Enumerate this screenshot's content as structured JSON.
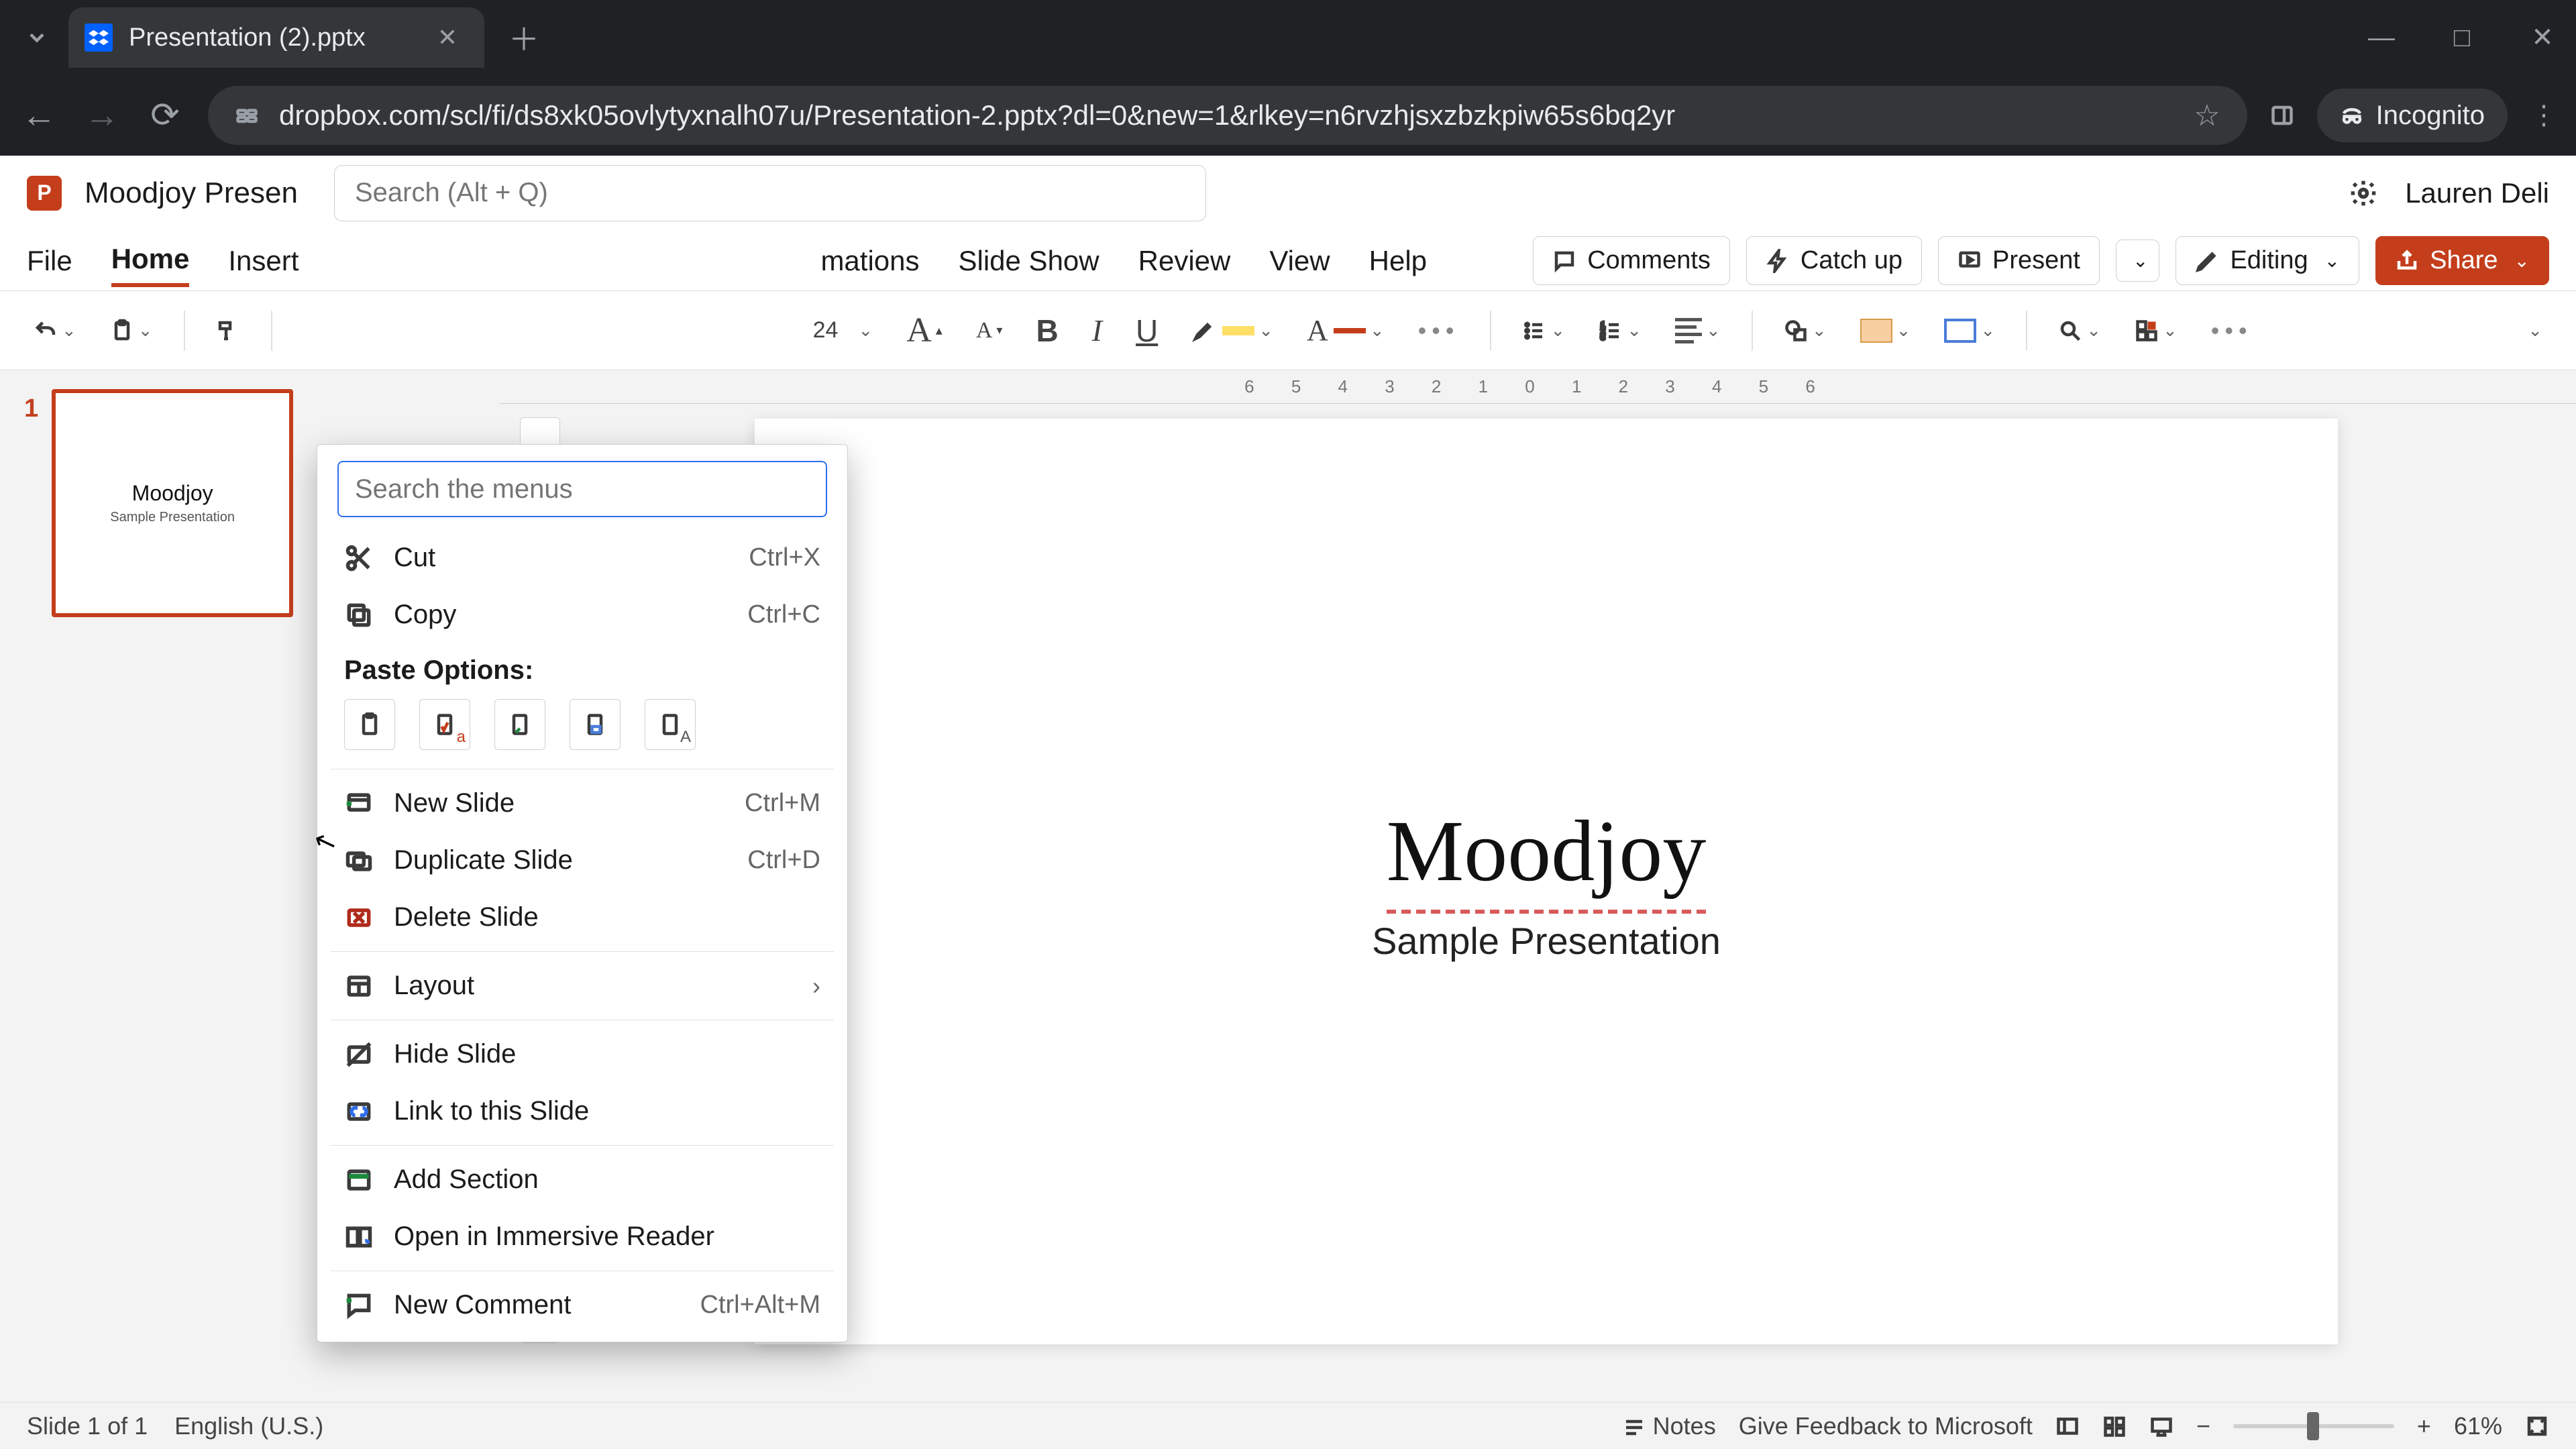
{
  "browser": {
    "tab_title": "Presentation (2).pptx",
    "url": "dropbox.com/scl/fi/ds8xk05ovlytyxnalh07u/Presentation-2.pptx?dl=0&new=1&rlkey=n6rvzhjsxzbzkpiw65s6bq2yr",
    "incognito_label": "Incognito"
  },
  "app_header": {
    "doc_title": "Moodjoy Presen",
    "search_placeholder": "Search (Alt + Q)",
    "user_name": "Lauren Deli"
  },
  "ribbon_tabs": {
    "items": [
      "File",
      "Home",
      "Insert",
      "mations",
      "Slide Show",
      "Review",
      "View",
      "Help"
    ],
    "active_index": 1
  },
  "ribbon_buttons": {
    "comments": "Comments",
    "catch_up": "Catch up",
    "present": "Present",
    "editing": "Editing",
    "share": "Share"
  },
  "toolbar": {
    "font_size_snippet": "24"
  },
  "thumbnail": {
    "number": "1",
    "title": "Moodjoy",
    "subtitle": "Sample Presentation"
  },
  "slide": {
    "title": "Moodjoy",
    "subtitle": "Sample Presentation"
  },
  "ruler": {
    "marks": "6     5     4     3     2     1     0     1     2     3     4     5     6"
  },
  "context_menu": {
    "search_placeholder": "Search the menus",
    "cut": {
      "label": "Cut",
      "shortcut": "Ctrl+X"
    },
    "copy": {
      "label": "Copy",
      "shortcut": "Ctrl+C"
    },
    "paste_header": "Paste Options:",
    "new_slide": {
      "label": "New Slide",
      "shortcut": "Ctrl+M"
    },
    "duplicate": {
      "label": "Duplicate Slide",
      "shortcut": "Ctrl+D"
    },
    "delete": {
      "label": "Delete Slide"
    },
    "layout": {
      "label": "Layout"
    },
    "hide": {
      "label": "Hide Slide"
    },
    "link": {
      "label": "Link to this Slide"
    },
    "add_section": {
      "label": "Add Section"
    },
    "immersive": {
      "label": "Open in Immersive Reader"
    },
    "new_comment": {
      "label": "New Comment",
      "shortcut": "Ctrl+Alt+M"
    }
  },
  "status": {
    "slide_counter": "Slide 1 of 1",
    "language": "English (U.S.)",
    "notes": "Notes",
    "feedback": "Give Feedback to Microsoft",
    "zoom_pct": "61%"
  },
  "colors": {
    "accent": "#c43e1c",
    "browser_bg": "#202124",
    "link_blue": "#2f6feb"
  }
}
